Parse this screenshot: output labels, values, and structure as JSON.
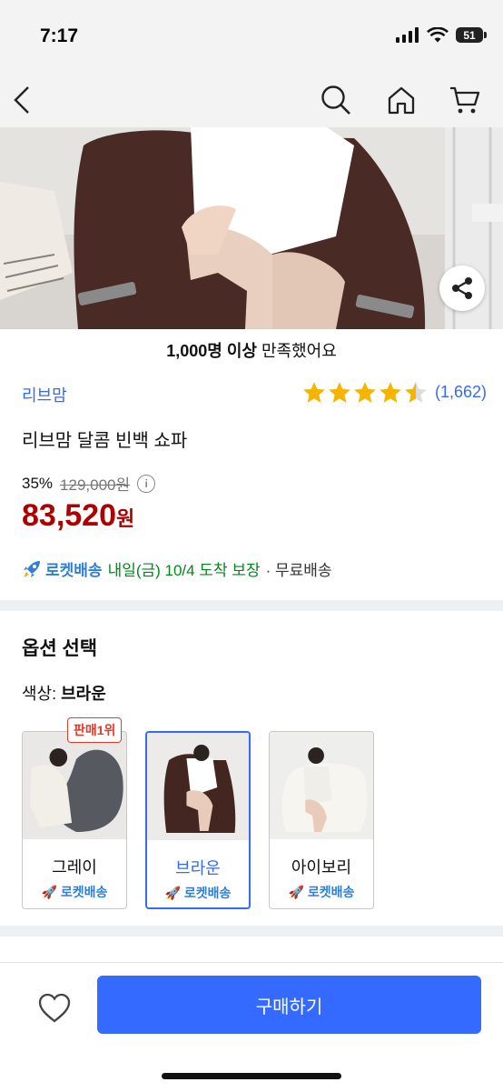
{
  "status": {
    "time": "7:17",
    "battery": "51"
  },
  "hero": {
    "satisfaction_bold": "1,000명 이상",
    "satisfaction_text": " 만족했어요"
  },
  "product": {
    "brand": "리브맘",
    "rating_value": 4.5,
    "rating_count": "(1,662)",
    "title": "리브맘 달콤 빈백 쇼파",
    "discount": "35%",
    "original_price": "129,000원",
    "price": "83,520",
    "price_unit": "원"
  },
  "delivery": {
    "rocket_label": "로켓배송",
    "date_text": "내일(금) 10/4 도착 보장",
    "free_text": "· 무료배송"
  },
  "options": {
    "title": "옵션 선택",
    "color_prefix": "색상: ",
    "selected_color": "브라운",
    "best_badge": "판매1위",
    "items": [
      {
        "name": "그레이",
        "rocket": "로켓배송",
        "selected": false
      },
      {
        "name": "브라운",
        "rocket": "로켓배송",
        "selected": true
      },
      {
        "name": "아이보리",
        "rocket": "로켓배송",
        "selected": false
      }
    ]
  },
  "bottom": {
    "buy_label": "구매하기"
  },
  "colors": {
    "accent": "#346aff",
    "price": "#ae0000",
    "arrival": "#00891a",
    "star": "#f5b400"
  }
}
